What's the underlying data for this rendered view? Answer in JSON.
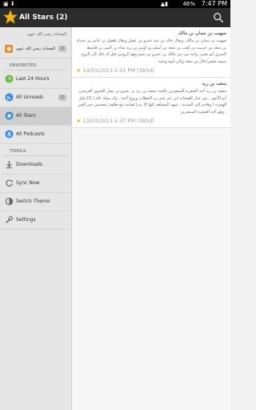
{
  "status_bar": {
    "time": "7:47 PM",
    "battery": "46%",
    "left_icons": "▣ ⬇"
  },
  "action_bar": {
    "title": "All Stars (2)",
    "star_icon": "star-icon",
    "search_icon": "search-icon"
  },
  "sidebar": {
    "header_text": "الصحابة رضي الله عنهم",
    "selected_feed": {
      "label": "الصحابة رضي الله عنهم",
      "badge": "11"
    },
    "favorites_label": "FAVORITES",
    "favorites": [
      {
        "label": "Last 24 Hours",
        "icon": "clock-icon",
        "badge": ""
      },
      {
        "label": "All Unreads",
        "icon": "rss-icon",
        "badge": "11"
      },
      {
        "label": "All Stars",
        "icon": "star-icon",
        "badge": ""
      },
      {
        "label": "All Podcasts",
        "icon": "podcast-icon",
        "badge": ""
      }
    ],
    "tools_label": "TOOLS",
    "tools": [
      {
        "label": "Downloads",
        "icon": "download-icon"
      },
      {
        "label": "Sync Now",
        "icon": "sync-icon"
      },
      {
        "label": "Switch Theme",
        "icon": "theme-icon"
      },
      {
        "label": "Settings",
        "icon": "wrench-icon"
      }
    ]
  },
  "articles": [
    {
      "title": "صهيب بن سنان بن مالك",
      "text": "صهيب بن سنان بن مالك، ويقال خالد بن عبد عمرو بن عقيل ويقال طفيل بن عامر بن جندلة بن سعد بن خزيمة بن كعب بن سعد بن أسلم بن أوس بن زيد مناة بن النمر بن قاسط النمري أبو يحيى. وأمه من بني مالك بن عمرو بن تميم وهو الرومي قيل له ذلك لأن الروم سبوه صغيرا قال بن سعد وكان أبوه وعمه",
      "date": "13/03/2013 5:51 PM (385d)"
    },
    {
      "title": "سعيد بن زيد",
      "text": "سعيد بن زيد أحد العشرة المبشرين بالجنة سعيد بن زيد بن عمرو بن نفيل العدوي القرشي، أبو الأعور ، من خيار الصحابة ابن عم عمر بن الخطاب وزوج أخته ، ولد بمكة عام ( 22 قبل الهجرة ) وهاجر إلى المدينة ، شهد المشاهد كلها إلا بدرا لقيامه مع طلحة بتجسس خبر العير ، وهو أحد العشرة المبشرين",
      "date": "13/03/2013 5:37 PM (385d)"
    }
  ],
  "colors": {
    "accent_star": "#f2b418",
    "action_bar": "#2c2c2c",
    "sidebar_bg": "#e6e6e6"
  }
}
